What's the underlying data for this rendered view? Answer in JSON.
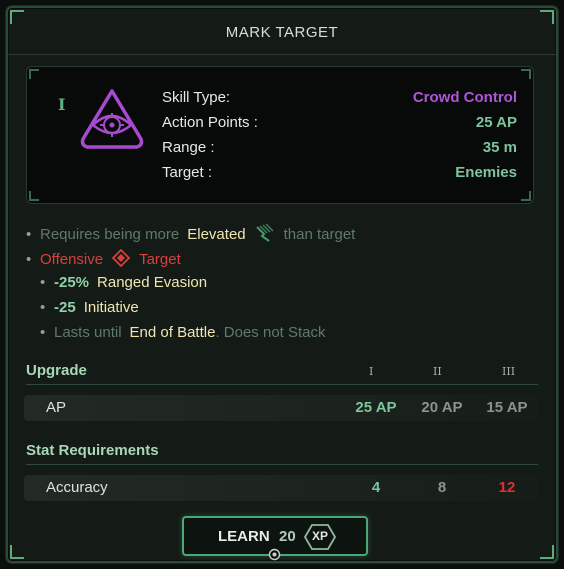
{
  "title": "MARK TARGET",
  "skill": {
    "tier": "I",
    "icon": "eye-target-icon",
    "stats": [
      {
        "label": "Skill Type:",
        "value": "Crowd Control"
      },
      {
        "label": "Action Points :",
        "value": "25 AP"
      },
      {
        "label": "Range :",
        "value": "35 m"
      },
      {
        "label": "Target :",
        "value": "Enemies"
      }
    ]
  },
  "effects": {
    "requires": {
      "prefix": "Requires being more",
      "keyword": "Elevated",
      "icon": "elevation-icon",
      "suffix": "than target"
    },
    "offensive": {
      "label": "Offensive",
      "icon": "target-diamond-icon",
      "keyword": "Target"
    },
    "ranged_evasion": {
      "value": "-25%",
      "label": "Ranged Evasion"
    },
    "initiative": {
      "value": "-25",
      "label": "Initiative"
    },
    "duration": {
      "prefix": "Lasts until",
      "keyword": "End of Battle",
      "suffix": ". Does not Stack"
    }
  },
  "upgrade": {
    "heading": "Upgrade",
    "tiers": [
      "I",
      "II",
      "III"
    ],
    "row": {
      "label": "AP",
      "values": [
        "25 AP",
        "20 AP",
        "15 AP"
      ]
    }
  },
  "requirements": {
    "heading": "Stat Requirements",
    "row": {
      "label": "Accuracy",
      "values": [
        "4",
        "8",
        "12"
      ]
    }
  },
  "learn": {
    "label": "LEARN",
    "cost": "20",
    "currency": "XP"
  },
  "colors": {
    "accent_green": "#4aa876",
    "skill_type_purple": "#b055d8",
    "stat_value_green": "#7fc49b",
    "offensive_red": "#d8403e",
    "keyword_cream": "#f0e6b4",
    "requirement_unmet_red": "#e0302e"
  }
}
